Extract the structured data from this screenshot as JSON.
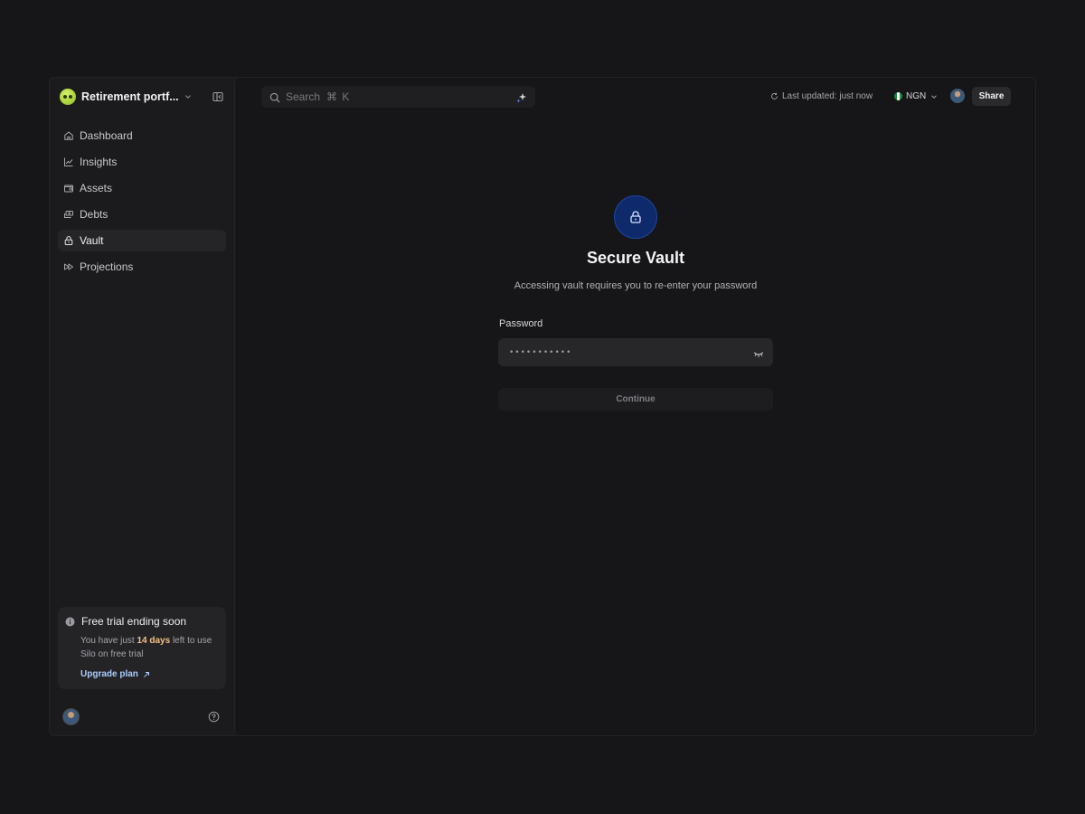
{
  "workspace": {
    "name": "Retirement portf..."
  },
  "sidebar": {
    "items": [
      {
        "label": "Dashboard",
        "icon": "home-icon"
      },
      {
        "label": "Insights",
        "icon": "chart-line-icon"
      },
      {
        "label": "Assets",
        "icon": "wallet-icon"
      },
      {
        "label": "Debts",
        "icon": "cash-icon"
      },
      {
        "label": "Vault",
        "icon": "lock-icon",
        "active": true
      },
      {
        "label": "Projections",
        "icon": "fast-forward-icon"
      }
    ],
    "trial": {
      "title": "Free trial ending soon",
      "text_before": "You have just ",
      "highlight": "14 days",
      "text_after": " left to use Silo on free trial",
      "upgrade_label": "Upgrade plan"
    }
  },
  "header": {
    "search": {
      "placeholder": "Search",
      "shortcut": "⌘ K"
    },
    "status": "Last updated: just now",
    "currency": "NGN",
    "share_label": "Share"
  },
  "vault": {
    "title": "Secure Vault",
    "subtitle": "Accessing vault requires you to re-enter your password",
    "password_label": "Password",
    "password_value": "•••••••••••",
    "continue_label": "Continue"
  },
  "colors": {
    "background": "#161618",
    "sidebar": "#1b1b1d",
    "accent_lock": "#0e2a6b",
    "highlight": "#f2c089",
    "link": "#a9cdfd"
  }
}
